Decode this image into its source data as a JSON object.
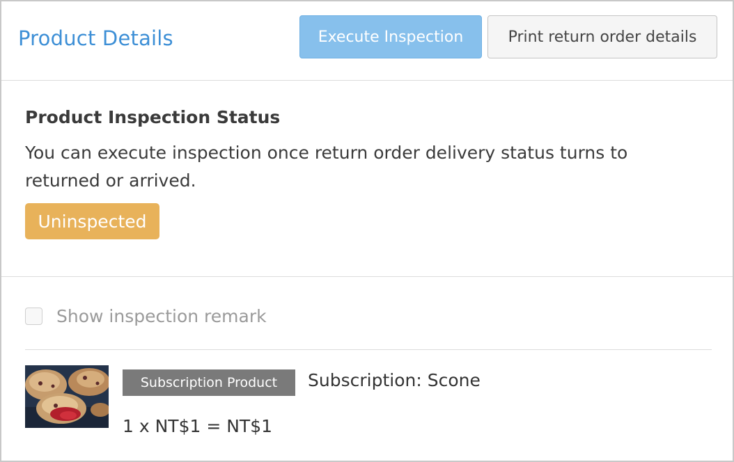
{
  "header": {
    "title": "Product Details",
    "execute_label": "Execute Inspection",
    "print_label": "Print return order details"
  },
  "inspection": {
    "heading": "Product Inspection Status",
    "description": "You can execute inspection once return order delivery status turns to returned or arrived.",
    "status": "Uninspected"
  },
  "remark": {
    "label": "Show inspection remark",
    "checked": false
  },
  "product": {
    "badge": "Subscription Product",
    "name": "Subscription: Scone",
    "price_line": "1 x NT$1 = NT$1",
    "image_icon": "scone-photo"
  },
  "colors": {
    "accent_blue": "#3d8fd6",
    "execute_button": "#87c0ec",
    "status_uninspected": "#e8b25a",
    "badge_gray": "#7a7a7a"
  }
}
